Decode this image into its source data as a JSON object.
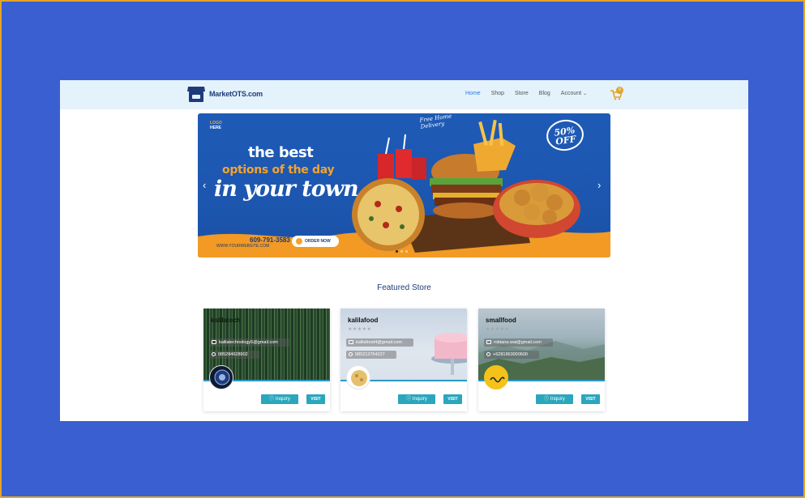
{
  "navbar": {
    "brand": "MarketOTS.com",
    "links": [
      "Home",
      "Shop",
      "Store",
      "Blog",
      "Account"
    ],
    "cart_count": "0"
  },
  "banner": {
    "logo_line1": "LOGO",
    "logo_line2": "HERE",
    "free_home": "Free Home",
    "delivery": "Delivery",
    "headline1": "the best",
    "headline2": "options of the day",
    "headline3": "in your town",
    "discount1": "50%",
    "discount2": "OFF",
    "phone": "609-791-3583",
    "website": "WWW.YOURWEBSITE.COM",
    "order_button": "ORDER NOW",
    "prev_arrow": "‹",
    "next_arrow": "›"
  },
  "featured": {
    "title": "Featured Store",
    "stores": [
      {
        "name": "kalilatech",
        "email": "kalilatechnology5@gmail.com",
        "phone": "085284628902",
        "inquiry": "Inquiry",
        "visit": "VISIT"
      },
      {
        "name": "kalilafood",
        "email": "kalilafood4@gmail.com",
        "phone": "085213764227",
        "inquiry": "Inquiry",
        "visit": "VISIT"
      },
      {
        "name": "smallfood",
        "email": "robiana.wai@gmail.com",
        "phone": "+6281963000600",
        "inquiry": "Inquiry",
        "visit": "VISIT"
      }
    ]
  },
  "colors": {
    "background": "#3a5fd0",
    "navbar": "#e4f2fb",
    "accent": "#2aa6bd",
    "brand": "#1d3b78",
    "banner_orange": "#f6a32c"
  }
}
